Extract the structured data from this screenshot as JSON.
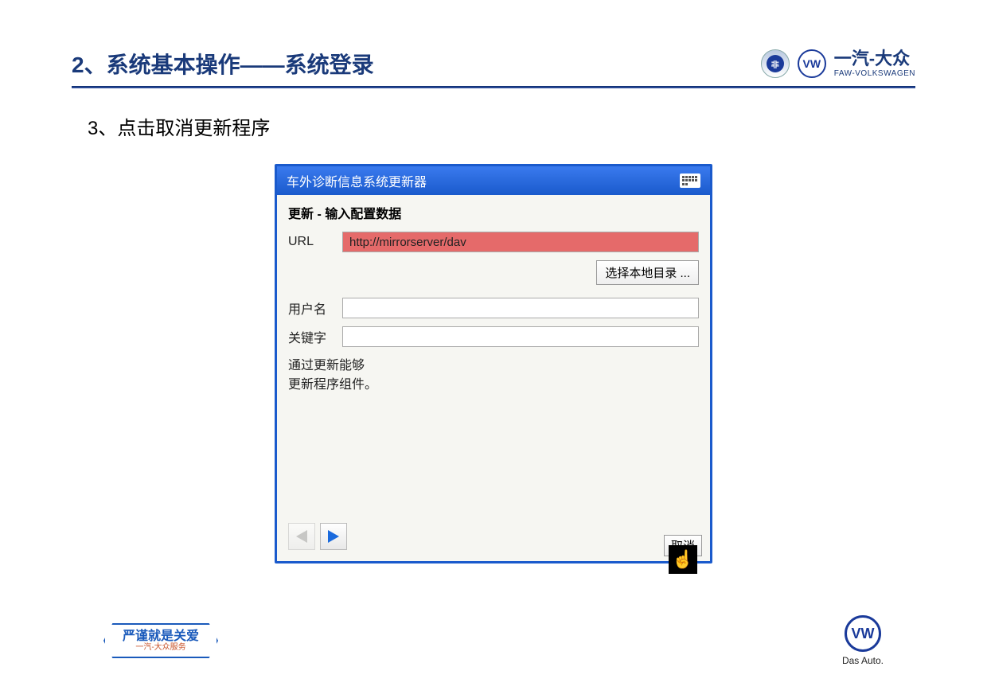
{
  "header": {
    "title": "2、系统基本操作——系统登录",
    "brand_cn": "一汽-大众",
    "brand_en": "FAW-VOLKSWAGEN"
  },
  "step": "3、点击取消更新程序",
  "dialog": {
    "title": "车外诊断信息系统更新器",
    "section_title": "更新 - 输入配置数据",
    "url_label": "URL",
    "url_value": "http://mirrorserver/dav",
    "dir_button": "选择本地目录 ...",
    "username_label": "用户名",
    "username_value": "",
    "keyword_label": "关键字",
    "keyword_value": "",
    "description_line1": "通过更新能够",
    "description_line2": "更新程序组件。",
    "cancel_label": "取消"
  },
  "footer": {
    "badge_cn": "严谨就是关爱",
    "badge_sub": "一汽-大众服务",
    "vw_tag": "Das Auto."
  }
}
